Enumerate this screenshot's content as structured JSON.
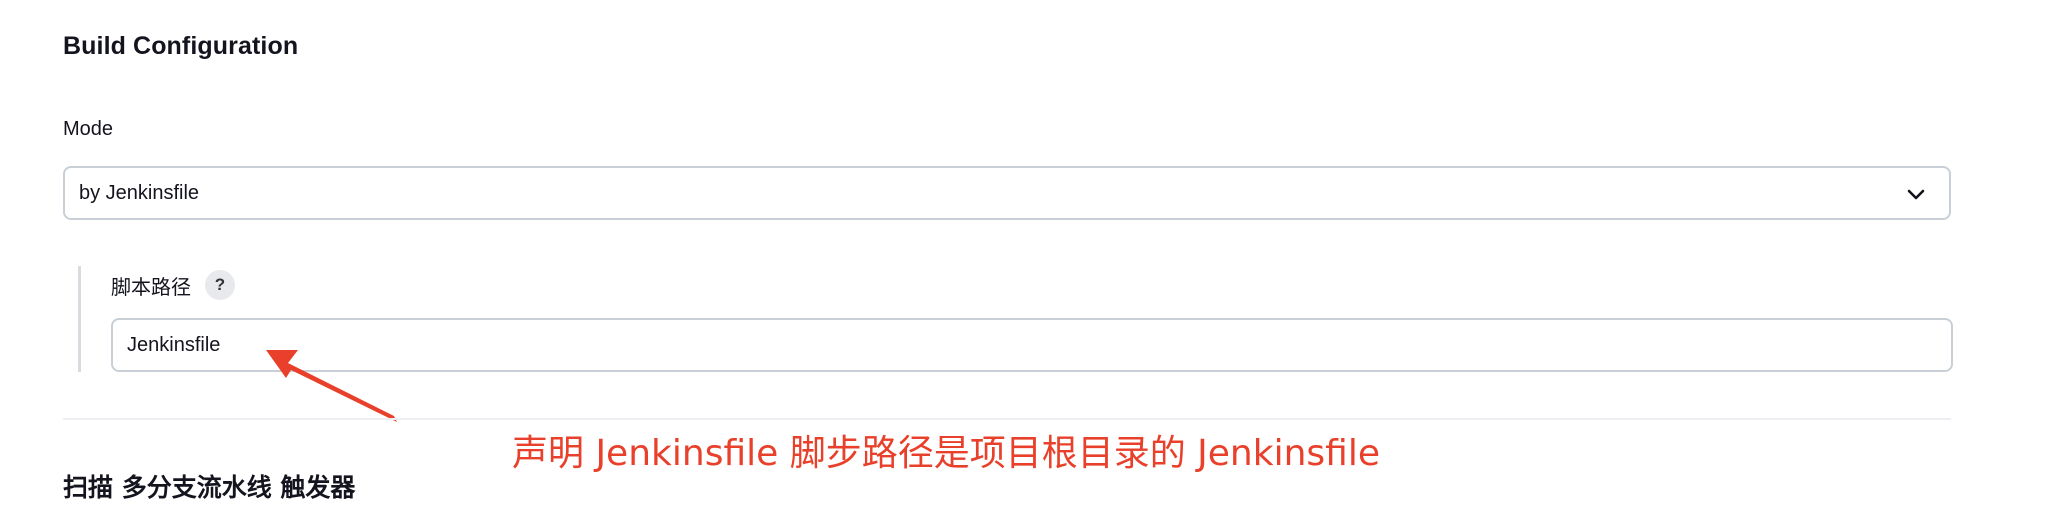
{
  "build_config": {
    "title": "Build Configuration",
    "mode_label": "Mode",
    "mode_value": "by Jenkinsfile",
    "script_path_label": "脚本路径",
    "help_glyph": "?",
    "script_path_value": "Jenkinsfile"
  },
  "annotation": {
    "text": "声明 Jenkinsfile 脚步路径是项目根目录的 Jenkinsfile",
    "color": "#e8402a"
  },
  "trigger_section": {
    "title": "扫描 多分支流水线 触发器"
  },
  "icons": {
    "dropdown": "chevron-down-icon",
    "help": "help-icon",
    "annotation_arrow": "arrow-icon"
  }
}
